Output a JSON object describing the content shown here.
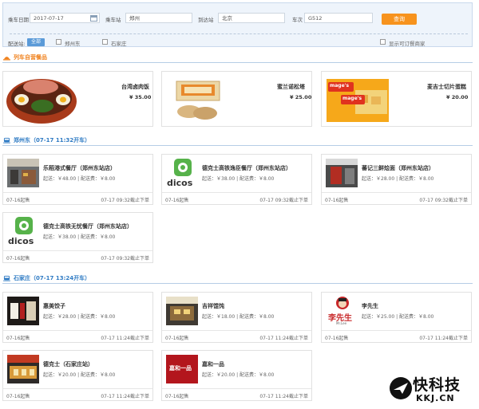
{
  "search": {
    "date_label": "乘车日期",
    "date_value": "2017-07-17",
    "from_label": "乘车站",
    "from_value": "郑州",
    "to_label": "到达站",
    "to_value": "北京",
    "train_label": "车次",
    "train_value": "G512",
    "query_button": "查询",
    "delivery_label": "配送站:",
    "stations": [
      "全部",
      "郑州东",
      "石家庄"
    ],
    "show_bookable": "显示可订餐商家"
  },
  "sections": {
    "train_self": "列车自营餐品",
    "zhengzhou": "郑州东（07-17 11:32开车）",
    "shijiazhuang": "石家庄（07-17 13:24开车）"
  },
  "train_items": [
    {
      "name": "台湾卤肉饭",
      "price": "¥ 35.00"
    },
    {
      "name": "蜜兰诺松塔",
      "price": "¥ 25.00"
    },
    {
      "name": "麦吉士切片蛋糕",
      "price": "¥ 20.00",
      "brand_text": "mage's"
    }
  ],
  "zz_shops": [
    {
      "name": "乐稻港式餐厅（郑州东站店）",
      "fee": "起送：￥48.00 | 配送费：￥8.00",
      "open": "07-16起售",
      "close": "07-17 09:32截止下单"
    },
    {
      "name": "德克士高铁逸臣餐厅（郑州东站店）",
      "fee": "起送：￥38.00 | 配送费：￥8.00",
      "open": "07-16起售",
      "close": "07-17 09:32截止下单",
      "logo": "dicos"
    },
    {
      "name": "蕃记三鲜烩面（郑州东站店）",
      "fee": "起送：￥28.00 | 配送费：￥8.00",
      "open": "07-16起售",
      "close": "07-17 09:32截止下单"
    },
    {
      "name": "德克士高铁无忧餐厅（郑州东站店）",
      "fee": "起送：￥38.00 | 配送费：￥8.00",
      "open": "07-16起售",
      "close": "07-17 09:32截止下单",
      "logo": "dicos"
    }
  ],
  "sjz_shops": [
    {
      "name": "惠美饺子",
      "fee": "起送：￥28.00 | 配送费：￥8.00",
      "open": "07-16起售",
      "close": "07-17 11:24截止下单"
    },
    {
      "name": "吉祥馄饨",
      "fee": "起送：￥18.00 | 配送费：￥8.00",
      "open": "07-16起售",
      "close": "07-17 11:24截止下单"
    },
    {
      "name": "李先生",
      "fee": "起送：￥25.00 | 配送费：￥8.00",
      "open": "07-16起售",
      "close": "07-17 11:24截止下单",
      "logo": "李先生",
      "logo_sub": "Mr.Lee"
    },
    {
      "name": "德克士（石家庄站）",
      "fee": "起送：￥20.00 | 配送费：￥8.00",
      "open": "07-16起售",
      "close": "07-17 11:24截止下单"
    },
    {
      "name": "嘉和一品",
      "fee": "起送：￥20.00 | 配送费：￥8.00",
      "open": "07-16起售",
      "close": "07-17 11:24截止下单",
      "logo": "嘉和一品"
    }
  ],
  "watermark": {
    "title": "快科技",
    "sub": "KKJ.CN"
  },
  "colors": {
    "accent": "#f7931d",
    "blue": "#2f7bc4",
    "tag": "#5a9ad8"
  }
}
